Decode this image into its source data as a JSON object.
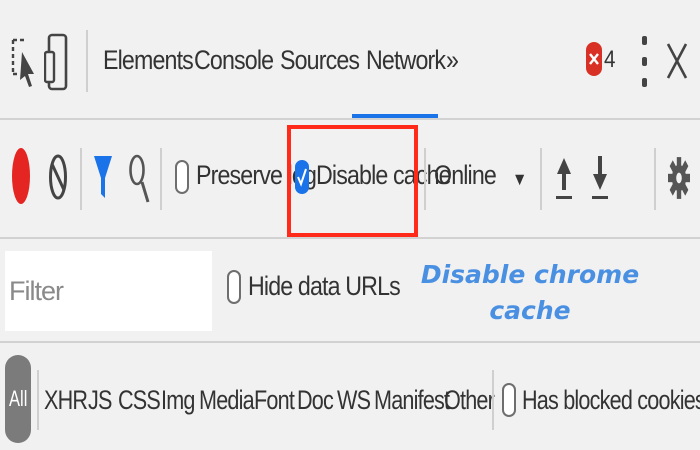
{
  "tabs": [
    {
      "label": "Elements",
      "active": false
    },
    {
      "label": "Console",
      "active": false
    },
    {
      "label": "Sources",
      "active": false
    },
    {
      "label": "Network",
      "active": true
    }
  ],
  "more_tabs_label": "»",
  "error_count": "4",
  "toolbar": {
    "preserve_log_label": "Preserve log",
    "preserve_log_checked": false,
    "disable_cache_label": "Disable cache",
    "disable_cache_checked": true,
    "throttling_value": "Online",
    "throttling_caret": "▼"
  },
  "filter_bar": {
    "filter_placeholder": "Filter",
    "hide_data_urls_label": "Hide data URLs",
    "hide_data_urls_checked": false
  },
  "caption": {
    "line1": "Disable chrome",
    "line2": "cache",
    "color": "#4a90e2"
  },
  "type_filters": {
    "all_label": "All",
    "items": [
      "XHR",
      "JS",
      "CSS",
      "Img",
      "Media",
      "Font",
      "Doc",
      "WS",
      "Manifest",
      "Other"
    ],
    "blocked_cookies_label": "Has blocked cookies",
    "blocked_cookies_checked": false
  },
  "colors": {
    "accent": "#1a73e8",
    "record": "#e52521",
    "highlight": "#ff2a1a",
    "error": "#d93025"
  }
}
